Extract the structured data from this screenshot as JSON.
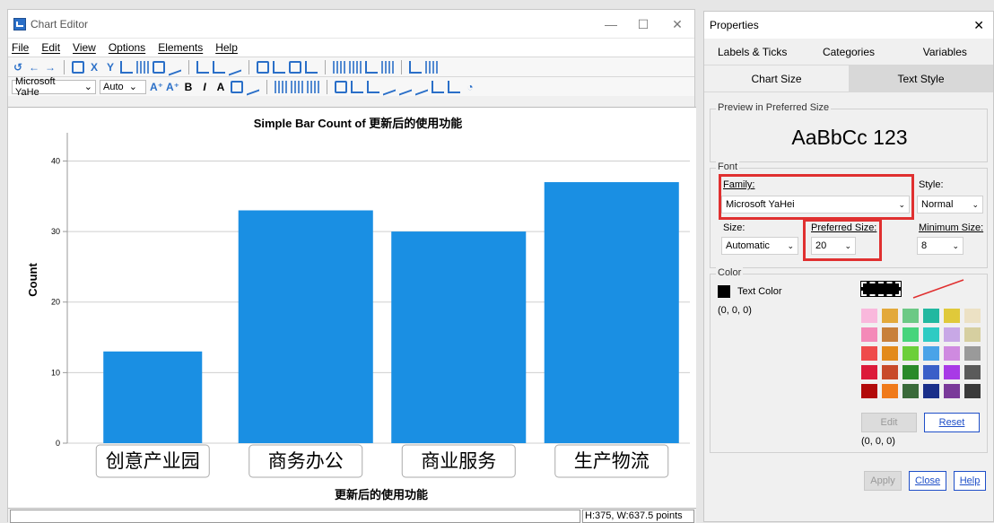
{
  "editor": {
    "title": "Chart Editor",
    "menus": [
      "File",
      "Edit",
      "View",
      "Options",
      "Elements",
      "Help"
    ],
    "font_combo": "Microsoft YaHe",
    "size_combo": "Auto",
    "status_dims": "H:375, W:637.5 points"
  },
  "chart_data": {
    "type": "bar",
    "title": "Simple Bar Count of 更新后的使用功能",
    "xlabel": "更新后的使用功能",
    "ylabel": "Count",
    "categories": [
      "创意产业园",
      "商务办公",
      "商业服务",
      "生产物流"
    ],
    "values": [
      13,
      33,
      30,
      37
    ],
    "ylim": [
      0,
      44
    ],
    "yticks": [
      0,
      10,
      20,
      30,
      40
    ],
    "bar_color": "#1a8fe3",
    "grid": true
  },
  "props": {
    "title": "Properties",
    "tabs_row1": [
      "Labels & Ticks",
      "Categories",
      "Variables"
    ],
    "tabs_row2": [
      "Chart Size",
      "Text Style"
    ],
    "preview_title": "Preview in Preferred Size",
    "preview_text": "AaBbCc 123",
    "font_title": "Font",
    "family_label": "Family:",
    "family_value": "Microsoft YaHei",
    "style_label": "Style:",
    "style_value": "Normal",
    "size_label": "Size:",
    "size_value": "Automatic",
    "pref_size_label": "Preferred Size:",
    "pref_size_value": "20",
    "min_size_label": "Minimum Size:",
    "min_size_value": "8",
    "color_title": "Color",
    "text_color_label": "Text Color",
    "text_color_value": "(0, 0, 0)",
    "edit_label": "Edit",
    "reset_label": "Reset",
    "palette_value": "(0, 0, 0)",
    "apply_label": "Apply",
    "close_label": "Close",
    "help_label": "Help",
    "palette": [
      [
        "#f9b8dc",
        "#e3a93a",
        "#6cc985",
        "#22b8a0",
        "#e0c93a",
        "#ece1c4"
      ],
      [
        "#f48ab8",
        "#c8803a",
        "#47d47c",
        "#2ecbc3",
        "#c8a8e6",
        "#d6cfa0"
      ],
      [
        "#ef4b4b",
        "#e38a1a",
        "#6ccf3a",
        "#4aa3e8",
        "#cf8ae0",
        "#9a9a9a"
      ],
      [
        "#dc1a3a",
        "#c84a2a",
        "#2a8a2a",
        "#3a5fc8",
        "#a83ae6",
        "#5a5a5a"
      ],
      [
        "#b20a0a",
        "#f07a1a",
        "#3a6a3a",
        "#1a2f8a",
        "#7a3a9a",
        "#3a3a3a"
      ]
    ]
  }
}
